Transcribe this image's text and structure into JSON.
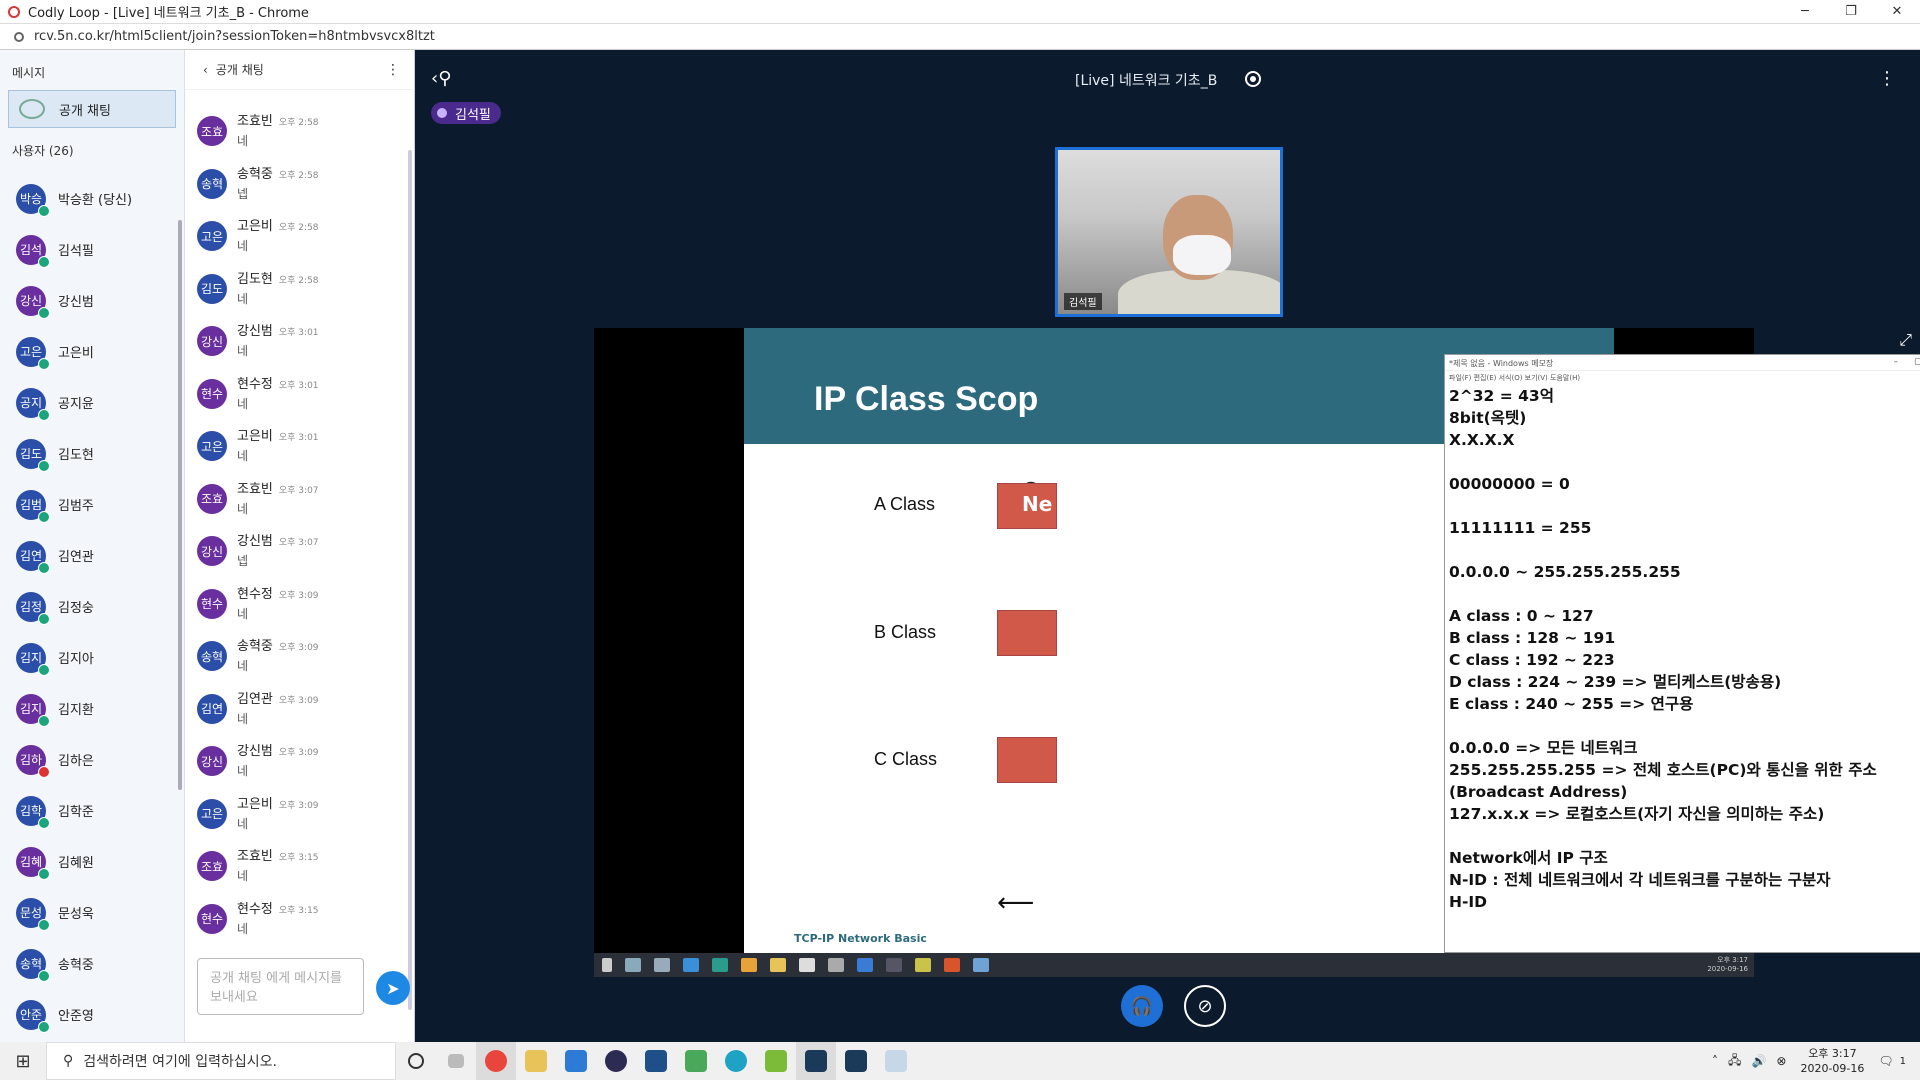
{
  "window": {
    "title": "Codly Loop - [Live] 네트워크 기초_B - Chrome",
    "url": "rcv.5n.co.kr/html5client/join?sessionToken=h8ntmbvsvcx8ltzt"
  },
  "users_panel": {
    "messages_label": "메시지",
    "public_chat_label": "공개 채팅",
    "users_count_label": "사용자 (26)",
    "users": [
      {
        "initials": "박승",
        "name": "박승환 (당신)",
        "color": "#2b4fa8",
        "mic": "on"
      },
      {
        "initials": "김석",
        "name": "김석필",
        "color": "#6a2f9e",
        "mic": "on"
      },
      {
        "initials": "강신",
        "name": "강신범",
        "color": "#6a2f9e",
        "mic": "on"
      },
      {
        "initials": "고은",
        "name": "고은비",
        "color": "#2b4fa8",
        "mic": "on"
      },
      {
        "initials": "공지",
        "name": "공지윤",
        "color": "#2b4fa8",
        "mic": "on"
      },
      {
        "initials": "김도",
        "name": "김도현",
        "color": "#2b4fa8",
        "mic": "on"
      },
      {
        "initials": "김범",
        "name": "김범주",
        "color": "#2b4fa8",
        "mic": "on"
      },
      {
        "initials": "김연",
        "name": "김연관",
        "color": "#2b4fa8",
        "mic": "on"
      },
      {
        "initials": "김정",
        "name": "김정숭",
        "color": "#2b4fa8",
        "mic": "on"
      },
      {
        "initials": "김지",
        "name": "김지아",
        "color": "#2b4fa8",
        "mic": "on"
      },
      {
        "initials": "김지",
        "name": "김지환",
        "color": "#6a2f9e",
        "mic": "on"
      },
      {
        "initials": "김하",
        "name": "김하은",
        "color": "#6a2f9e",
        "mic": "off"
      },
      {
        "initials": "김학",
        "name": "김학준",
        "color": "#2b4fa8",
        "mic": "on"
      },
      {
        "initials": "김혜",
        "name": "김혜원",
        "color": "#6a2f9e",
        "mic": "on"
      },
      {
        "initials": "문성",
        "name": "문성욱",
        "color": "#2b4fa8",
        "mic": "on"
      },
      {
        "initials": "송혁",
        "name": "송혁중",
        "color": "#2b4fa8",
        "mic": "on"
      },
      {
        "initials": "안준",
        "name": "안준영",
        "color": "#2b4fa8",
        "mic": "on"
      }
    ]
  },
  "chat_panel": {
    "title": "공개 채팅",
    "input_placeholder": "공개 채팅 에게 메시지를 보내세요",
    "messages": [
      {
        "initials": "조효",
        "name": "조효빈",
        "time": "오후 2:58",
        "text": "네",
        "color": "#6a2f9e"
      },
      {
        "initials": "송혁",
        "name": "송혁중",
        "time": "오후 2:58",
        "text": "넵",
        "color": "#2b4fa8"
      },
      {
        "initials": "고은",
        "name": "고은비",
        "time": "오후 2:58",
        "text": "네",
        "color": "#2b4fa8"
      },
      {
        "initials": "김도",
        "name": "김도현",
        "time": "오후 2:58",
        "text": "네",
        "color": "#2b4fa8"
      },
      {
        "initials": "강신",
        "name": "강신범",
        "time": "오후 3:01",
        "text": "네",
        "color": "#6a2f9e"
      },
      {
        "initials": "현수",
        "name": "현수정",
        "time": "오후 3:01",
        "text": "네",
        "color": "#6a2f9e"
      },
      {
        "initials": "고은",
        "name": "고은비",
        "time": "오후 3:01",
        "text": "네",
        "color": "#2b4fa8"
      },
      {
        "initials": "조효",
        "name": "조효빈",
        "time": "오후 3:07",
        "text": "네",
        "color": "#6a2f9e"
      },
      {
        "initials": "강신",
        "name": "강신범",
        "time": "오후 3:07",
        "text": "넵",
        "color": "#6a2f9e"
      },
      {
        "initials": "현수",
        "name": "현수정",
        "time": "오후 3:09",
        "text": "네",
        "color": "#6a2f9e"
      },
      {
        "initials": "송혁",
        "name": "송혁중",
        "time": "오후 3:09",
        "text": "네",
        "color": "#2b4fa8"
      },
      {
        "initials": "김연",
        "name": "김연관",
        "time": "오후 3:09",
        "text": "네",
        "color": "#2b4fa8"
      },
      {
        "initials": "강신",
        "name": "강신범",
        "time": "오후 3:09",
        "text": "네",
        "color": "#6a2f9e"
      },
      {
        "initials": "고은",
        "name": "고은비",
        "time": "오후 3:09",
        "text": "네",
        "color": "#2b4fa8"
      },
      {
        "initials": "조효",
        "name": "조효빈",
        "time": "오후 3:15",
        "text": "네",
        "color": "#6a2f9e"
      },
      {
        "initials": "현수",
        "name": "현수정",
        "time": "오후 3:15",
        "text": "네",
        "color": "#6a2f9e"
      }
    ]
  },
  "main": {
    "session_title": "[Live] 네트워크 기초_B",
    "presenter_name": "김석필",
    "webcam_name": "김석필"
  },
  "slide": {
    "title": "IP Class Scop",
    "bits_label": "8",
    "a_class": "A Class",
    "b_class": "B Class",
    "c_class": "C Class",
    "box_text": "Ne",
    "footer": "TCP-IP Network Basic"
  },
  "notepad": {
    "title": "*제목 없음 - Windows 메모장",
    "menu": "파일(F)   편집(E)   서식(O)   보기(V)   도움말(H)",
    "text": "2^32 = 43억\n8bit(옥텟)\nX.X.X.X\n\n00000000 = 0\n\n11111111 = 255\n\n0.0.0.0 ~ 255.255.255.255\n\nA class : 0 ~ 127\nB class : 128 ~ 191\nC class : 192 ~ 223\nD class : 224 ~ 239 => 멀티케스트(방송용)\nE class : 240 ~ 255 => 연구용\n\n0.0.0.0 => 모든 네트워크\n255.255.255.255 => 전체 호스트(PC)와 통신을 위한 주소\n(Broadcast Address)\n127.x.x.x => 로컬호스트(자기 자신을 의미하는 주소)\n\nNetwork에서 IP 구조\nN-ID : 전체 네트워크에서 각 네트워크를 구분하는 구분자\nH-ID"
  },
  "inner_taskbar": {
    "time": "오후 3:17",
    "date": "2020-09-16"
  },
  "taskbar": {
    "search_placeholder": "검색하려면 여기에 입력하십시오.",
    "time": "오후 3:17",
    "date": "2020-09-16",
    "notification_count": "1"
  }
}
